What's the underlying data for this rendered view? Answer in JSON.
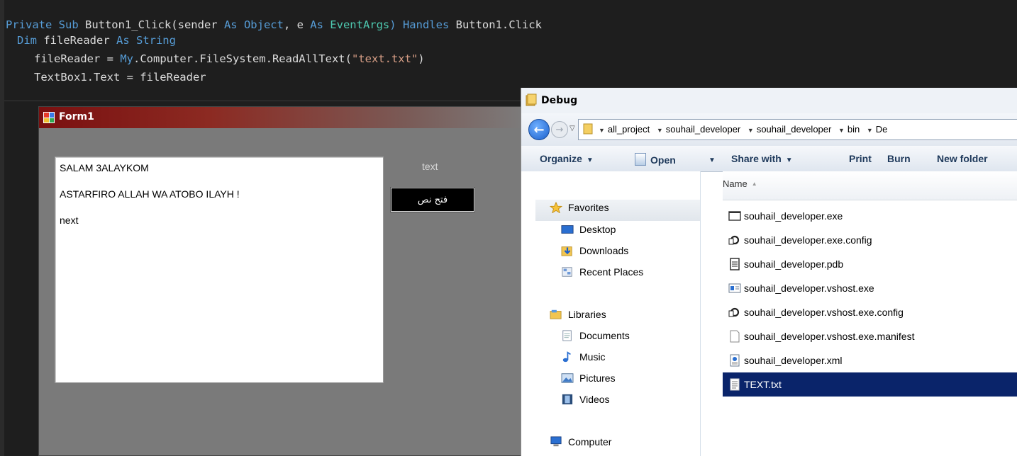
{
  "code": {
    "line1": {
      "kw1": "Private Sub ",
      "name": "Button1_Click(sender ",
      "kw2": "As ",
      "ty1": "Object",
      "mid": ", e ",
      "kw3": "As ",
      "ty2": "EventArgs",
      "close": ") ",
      "kw4": "Handles ",
      "handler": "Button1.Click"
    },
    "line2": {
      "kw1": "Dim ",
      "name": "fileReader ",
      "kw2": "As ",
      "kw3": "String"
    },
    "line3": {
      "pre": "fileReader = ",
      "my": "My",
      "call": ".Computer.FileSystem.ReadAllText(",
      "str": "\"text.txt\"",
      "end": ")"
    },
    "line4": {
      "text": "TextBox1.Text = fileReader"
    }
  },
  "form1": {
    "title": "Form1",
    "textbox_lines": [
      "SALAM 3ALAYKOM",
      "ASTARFIRO ALLAH WA ATOBO ILAYH !",
      "next"
    ],
    "label": "text",
    "button": "فتح نص"
  },
  "explorer": {
    "title": "Debug",
    "breadcrumbs": [
      "all_project",
      "souhail_developer",
      "souhail_developer",
      "bin",
      "De"
    ],
    "toolbar": {
      "organize": "Organize",
      "open": "Open",
      "share_with": "Share with",
      "print": "Print",
      "burn": "Burn",
      "new_folder": "New folder"
    },
    "nav": {
      "favorites": "Favorites",
      "desktop": "Desktop",
      "downloads": "Downloads",
      "recent_places": "Recent Places",
      "libraries": "Libraries",
      "documents": "Documents",
      "music": "Music",
      "pictures": "Pictures",
      "videos": "Videos",
      "computer": "Computer"
    },
    "column_name": "Name",
    "files": [
      {
        "name": "souhail_developer.exe",
        "icon": "app-window-icon"
      },
      {
        "name": "souhail_developer.exe.config",
        "icon": "config-icon"
      },
      {
        "name": "souhail_developer.pdb",
        "icon": "document-icon"
      },
      {
        "name": "souhail_developer.vshost.exe",
        "icon": "vshost-app-icon"
      },
      {
        "name": "souhail_developer.vshost.exe.config",
        "icon": "config-icon"
      },
      {
        "name": "souhail_developer.vshost.exe.manifest",
        "icon": "blank-file-icon"
      },
      {
        "name": "souhail_developer.xml",
        "icon": "xml-file-icon"
      },
      {
        "name": "TEXT.txt",
        "icon": "text-file-icon"
      }
    ],
    "selected_file": "TEXT.txt"
  }
}
